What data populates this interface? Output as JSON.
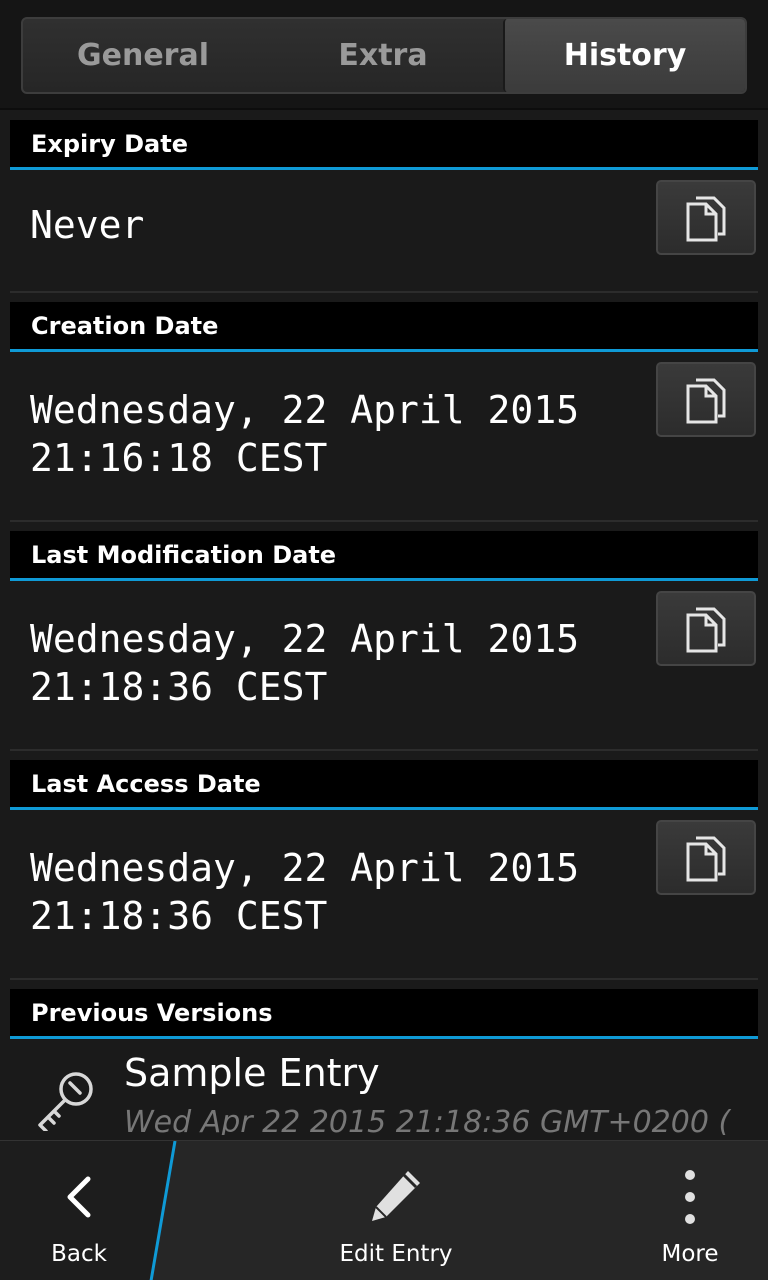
{
  "tabs": [
    {
      "label": "General",
      "active": false
    },
    {
      "label": "Extra",
      "active": false
    },
    {
      "label": "History",
      "active": true
    }
  ],
  "sections": {
    "expiry": {
      "title": "Expiry Date",
      "value": "Never"
    },
    "creation": {
      "title": "Creation Date",
      "value": "Wednesday, 22 April 2015\n21:16:18 CEST"
    },
    "modification": {
      "title": "Last Modification Date",
      "value": "Wednesday, 22 April 2015\n21:18:36 CEST"
    },
    "access": {
      "title": "Last Access Date",
      "value": "Wednesday, 22 April 2015\n21:18:36 CEST"
    }
  },
  "previous_versions": {
    "title": "Previous Versions",
    "items": [
      {
        "icon": "key-icon",
        "title": "Sample Entry",
        "subtitle": "Wed Apr 22 2015 21:18:36 GMT+0200 ("
      }
    ]
  },
  "actions": {
    "back": "Back",
    "edit": "Edit Entry",
    "more": "More"
  },
  "colors": {
    "accent": "#0f9ad6",
    "background": "#1a1a1a",
    "header_bg": "#000000"
  }
}
